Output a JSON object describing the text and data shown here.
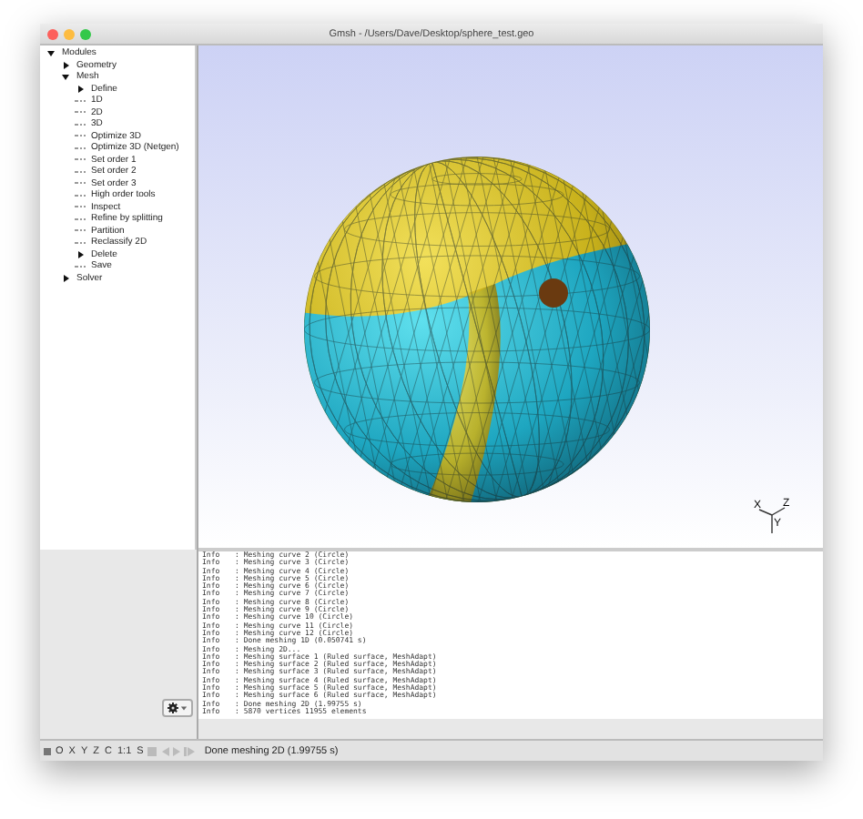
{
  "window": {
    "title": "Gmsh - /Users/Dave/Desktop/sphere_test.geo"
  },
  "tree": [
    {
      "label": "Modules",
      "expanded": true,
      "children": [
        {
          "label": "Geometry",
          "expanded": false
        },
        {
          "label": "Mesh",
          "expanded": true,
          "children": [
            {
              "label": "Define",
              "expanded": false
            },
            {
              "label": "1D"
            },
            {
              "label": "2D"
            },
            {
              "label": "3D"
            },
            {
              "label": "Optimize 3D"
            },
            {
              "label": "Optimize 3D (Netgen)"
            },
            {
              "label": "Set order 1"
            },
            {
              "label": "Set order 2"
            },
            {
              "label": "Set order 3"
            },
            {
              "label": "High order tools"
            },
            {
              "label": "Inspect"
            },
            {
              "label": "Refine by splitting"
            },
            {
              "label": "Partition"
            },
            {
              "label": "Reclassify 2D"
            },
            {
              "label": "Delete",
              "expanded": false
            },
            {
              "label": "Save"
            }
          ]
        },
        {
          "label": "Solver",
          "expanded": false
        }
      ]
    }
  ],
  "axes": {
    "x_label": "X",
    "y_label": "Y",
    "z_label": "Z"
  },
  "log": [
    {
      "level": "Info",
      "message": ": Meshing curve 2 (Circle)"
    },
    {
      "level": "Info",
      "message": ": Meshing curve 3 (Circle)"
    },
    {
      "level": "Info",
      "message": ": Meshing curve 4 (Circle)"
    },
    {
      "level": "Info",
      "message": ": Meshing curve 5 (Circle)"
    },
    {
      "level": "Info",
      "message": ": Meshing curve 6 (Circle)"
    },
    {
      "level": "Info",
      "message": ": Meshing curve 7 (Circle)"
    },
    {
      "level": "Info",
      "message": ": Meshing curve 8 (Circle)"
    },
    {
      "level": "Info",
      "message": ": Meshing curve 9 (Circle)"
    },
    {
      "level": "Info",
      "message": ": Meshing curve 10 (Circle)"
    },
    {
      "level": "Info",
      "message": ": Meshing curve 11 (Circle)"
    },
    {
      "level": "Info",
      "message": ": Meshing curve 12 (Circle)"
    },
    {
      "level": "Info",
      "message": ": Done meshing 1D (0.050741 s)"
    },
    {
      "level": "Info",
      "message": ": Meshing 2D..."
    },
    {
      "level": "Info",
      "message": ": Meshing surface 1 (Ruled surface, MeshAdapt)"
    },
    {
      "level": "Info",
      "message": ": Meshing surface 2 (Ruled surface, MeshAdapt)"
    },
    {
      "level": "Info",
      "message": ": Meshing surface 3 (Ruled surface, MeshAdapt)"
    },
    {
      "level": "Info",
      "message": ": Meshing surface 4 (Ruled surface, MeshAdapt)"
    },
    {
      "level": "Info",
      "message": ": Meshing surface 5 (Ruled surface, MeshAdapt)"
    },
    {
      "level": "Info",
      "message": ": Meshing surface 6 (Ruled surface, MeshAdapt)"
    },
    {
      "level": "Info",
      "message": ": Done meshing 2D (1.99755 s)"
    },
    {
      "level": "Info",
      "message": ": 5870 vertices 11955 elements"
    }
  ],
  "status_bar": {
    "view_buttons": [
      "O",
      "X",
      "Y",
      "Z",
      "C",
      "1:1",
      "S"
    ],
    "message": "Done meshing 2D (1.99755 s)"
  }
}
